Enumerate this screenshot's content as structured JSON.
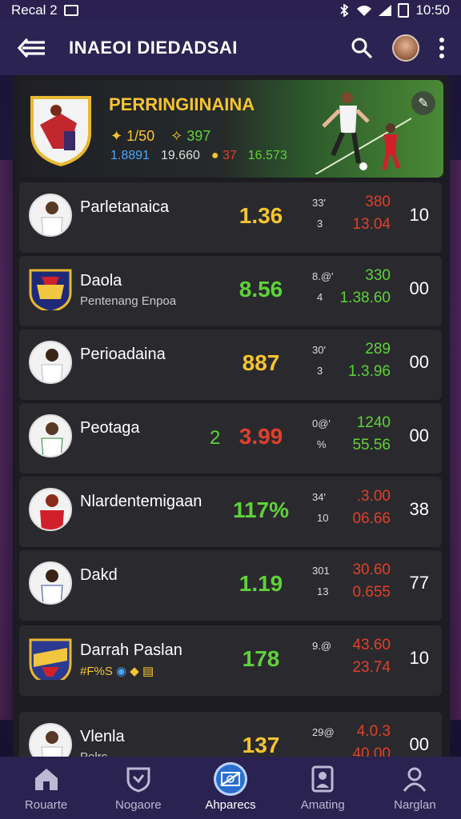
{
  "status_bar": {
    "carrier": "Recal 2",
    "time": "10:50"
  },
  "app_bar": {
    "title": "INAEOI DIEDADSAI"
  },
  "colors": {
    "accent": "#2a6fd0",
    "yellow": "#f5c430",
    "green": "#5fd13a",
    "red": "#e0402a",
    "blue": "#4aa8ff"
  },
  "banner": {
    "title": "PERRINGIINAINA",
    "stat_a1": "1/50",
    "stat_a2": "397",
    "stat_b1": "1.8891",
    "stat_b2": "19.660",
    "stat_b3": "37",
    "stat_b4": "16.573"
  },
  "matches": [
    {
      "name": "Parletanaica",
      "sub": "",
      "pre": "",
      "main": "1.36",
      "main_color": "#f5c430",
      "odd_a": "33'",
      "odd_b": "3",
      "val_a": "380",
      "val_a_color": "#e0402a",
      "val_b": "13.04",
      "val_b_color": "#e0402a",
      "count": "10",
      "pic": "white"
    },
    {
      "name": "Daola",
      "sub": "Pentenang Enpoa",
      "pre": "",
      "main": "8.56",
      "main_color": "#5fd13a",
      "odd_a": "8.@'",
      "odd_b": "4",
      "val_a": "330",
      "val_a_color": "#5fd13a",
      "val_b": "1.38.60",
      "val_b_color": "#5fd13a",
      "count": "00",
      "pic": "crest"
    },
    {
      "name": "Perioadaina",
      "sub": "",
      "pre": "",
      "main": "887",
      "main_color": "#f5c430",
      "odd_a": "30'",
      "odd_b": "3",
      "val_a": "289",
      "val_a_color": "#5fd13a",
      "val_b": "1.3.96",
      "val_b_color": "#5fd13a",
      "count": "00",
      "pic": "white"
    },
    {
      "name": "Peotaga",
      "sub": "",
      "pre": "2",
      "main": "3.99",
      "main_color": "#e0402a",
      "odd_a": "0@'",
      "odd_b": "%",
      "val_a": "1240",
      "val_a_color": "#5fd13a",
      "val_b": "55.56",
      "val_b_color": "#5fd13a",
      "count": "00",
      "pic": "white"
    },
    {
      "name": "Nlardentemigaan",
      "sub": "",
      "pre": "",
      "main": "117%",
      "main_color": "#5fd13a",
      "odd_a": "34'",
      "odd_b": "10",
      "val_a": ".3.00",
      "val_a_color": "#e0402a",
      "val_b": "06.66",
      "val_b_color": "#e0402a",
      "count": "38",
      "pic": "red"
    },
    {
      "name": "Dakd",
      "sub": "",
      "pre": "",
      "main": "1.19",
      "main_color": "#5fd13a",
      "odd_a": "301",
      "odd_b": "13",
      "val_a": "30.60",
      "val_a_color": "#e0402a",
      "val_b": "0.655",
      "val_b_color": "#e0402a",
      "count": "77",
      "pic": "white"
    },
    {
      "name": "Darrah Paslan",
      "sub": "#F%S",
      "pre": "",
      "main": "178",
      "main_color": "#5fd13a",
      "odd_a": "9.@",
      "odd_b": "",
      "val_a": "43.60",
      "val_a_color": "#e0402a",
      "val_b": "23.74",
      "val_b_color": "#e0402a",
      "count": "10",
      "pic": "crest"
    },
    {
      "name": "Vlenla",
      "sub": "Pelrc",
      "pre": "",
      "main": "137",
      "main_color": "#f5c430",
      "odd_a": "29@",
      "odd_b": "",
      "val_a": "4.0.3",
      "val_a_color": "#e0402a",
      "val_b": "40.00",
      "val_b_color": "#e0402a",
      "count": "00",
      "pic": "white"
    }
  ],
  "tabs": [
    {
      "label": "Rouarte",
      "icon": "home-icon"
    },
    {
      "label": "Nogaore",
      "icon": "shield-icon"
    },
    {
      "label": "Ahparecs",
      "icon": "soccer-field-icon",
      "active": true
    },
    {
      "label": "Amating",
      "icon": "player-card-icon"
    },
    {
      "label": "Narglan",
      "icon": "profile-icon"
    }
  ]
}
